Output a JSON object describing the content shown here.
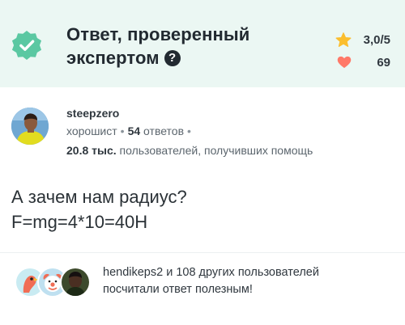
{
  "verified": {
    "title_line1": "Ответ, проверенный",
    "title_line2": "экспертом",
    "help_glyph": "?",
    "rating": "3,0/5",
    "thanks_count": "69",
    "colors": {
      "header_bg": "#ebf7f3",
      "badge": "#5bc8a2",
      "star": "#fbbe2e",
      "heart": "#ff7968"
    }
  },
  "author": {
    "name": "steepzero",
    "rank": "хорошист",
    "answers_count": "54",
    "answers_label": "ответов",
    "helped_count": "20.8 тыс.",
    "helped_label": "пользователей, получивших помощь"
  },
  "answer": {
    "line1": "А зачем нам радиус?",
    "line2": "F=mg=4*10=40Н"
  },
  "thanks": {
    "line1": "hendikeps2 и 108 других пользователей",
    "line2": "посчитали ответ полезным!",
    "avatars": [
      "parrot-avatar",
      "clown-avatar",
      "person-avatar"
    ]
  }
}
